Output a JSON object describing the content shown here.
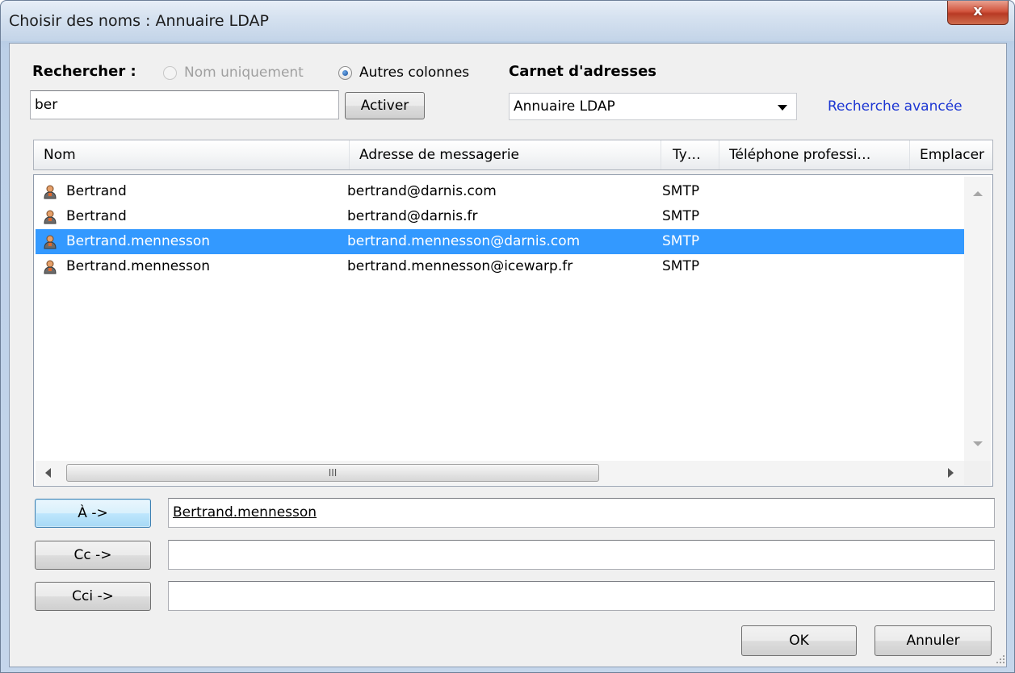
{
  "window": {
    "title": "Choisir des noms : Annuaire LDAP",
    "close_label": "x"
  },
  "search": {
    "label": "Rechercher :",
    "radio_name_only": "Nom uniquement",
    "radio_other_columns": "Autres colonnes",
    "query": "ber",
    "go_button": "Activer",
    "selected_mode": "Autres colonnes"
  },
  "address_book": {
    "label": "Carnet d'adresses",
    "selected": "Annuaire LDAP",
    "advanced_link": "Recherche avancée"
  },
  "list": {
    "columns": [
      "Nom",
      "Adresse de messagerie",
      "Ty…",
      "Téléphone professi…",
      "Emplacer"
    ],
    "rows": [
      {
        "name": "Bertrand",
        "email": "bertrand@darnis.com",
        "type": "SMTP"
      },
      {
        "name": "Bertrand",
        "email": "bertrand@darnis.fr",
        "type": "SMTP"
      },
      {
        "name": "Bertrand.mennesson",
        "email": "bertrand.mennesson@darnis.com",
        "type": "SMTP"
      },
      {
        "name": "Bertrand.mennesson",
        "email": "bertrand.mennesson@icewarp.fr",
        "type": "SMTP"
      }
    ],
    "selected_row_index": 2,
    "hscroll_thumb_label": "III"
  },
  "recipients": {
    "to_button": "À ->",
    "to_value": "Bertrand.mennesson",
    "cc_button": "Cc ->",
    "cc_value": "",
    "bcc_button": "Cci ->",
    "bcc_value": ""
  },
  "actions": {
    "ok": "OK",
    "cancel": "Annuler"
  },
  "colors": {
    "selection": "#3399ff",
    "link": "#1c36d3",
    "close": "#c8462f"
  },
  "icons": {
    "contact": "person-icon",
    "close": "close-icon",
    "dropdown": "chevron-down-icon"
  }
}
